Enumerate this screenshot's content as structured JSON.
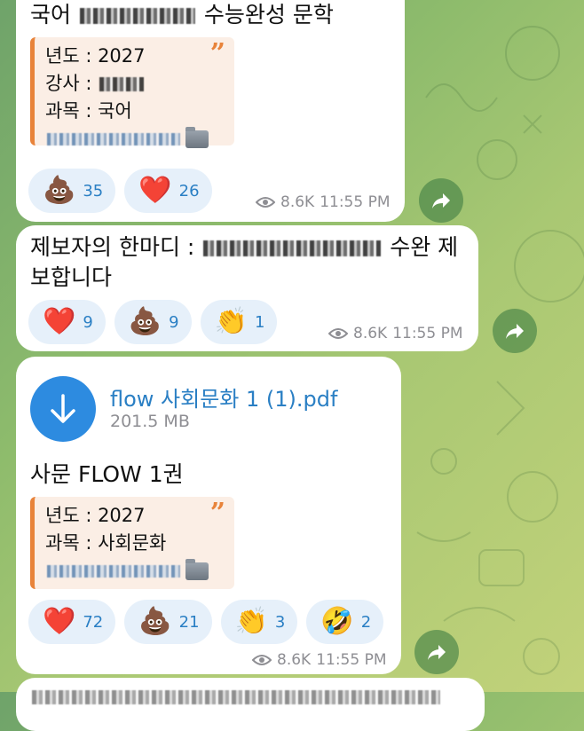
{
  "messages": [
    {
      "title_prefix": "국어",
      "title_suffix": "수능완성 문학",
      "quote_lines": [
        "년도 : 2027",
        "강사 :",
        "과목 : 국어"
      ],
      "reactions": [
        {
          "icon": "poop-emoji",
          "glyph": "💩",
          "count": "35"
        },
        {
          "icon": "heart-emoji",
          "glyph": "❤️",
          "count": "26"
        }
      ],
      "views": "8.6K",
      "time": "11:55 PM"
    },
    {
      "text_line1_prefix": "제보자의 한마디 :",
      "text_line1_suffix": "수완 제",
      "text_line2": "보합니다",
      "reactions": [
        {
          "icon": "heart-emoji",
          "glyph": "❤️",
          "count": "9"
        },
        {
          "icon": "poop-emoji",
          "glyph": "💩",
          "count": "9"
        },
        {
          "icon": "clap-emoji",
          "glyph": "👏",
          "count": "1"
        }
      ],
      "views": "8.6K",
      "time": "11:55 PM"
    },
    {
      "file_name": "flow 사회문화 1 (1).pdf",
      "file_size": "201.5 MB",
      "caption": "사문 FLOW 1권",
      "quote_lines": [
        "년도 : 2027",
        "과목 : 사회문화"
      ],
      "reactions": [
        {
          "icon": "heart-emoji",
          "glyph": "❤️",
          "count": "72"
        },
        {
          "icon": "poop-emoji",
          "glyph": "💩",
          "count": "21"
        },
        {
          "icon": "clap-emoji",
          "glyph": "👏",
          "count": "3"
        },
        {
          "icon": "rofl-emoji",
          "glyph": "🤣",
          "count": "2"
        }
      ],
      "views": "8.6K",
      "time": "11:55 PM"
    }
  ],
  "colors": {
    "accent": "#2a7fc4",
    "quote_bar": "#e8833a",
    "quote_bg": "#fbeee5",
    "reaction_bg": "#e6f0fa",
    "meta": "#8e8e93"
  }
}
